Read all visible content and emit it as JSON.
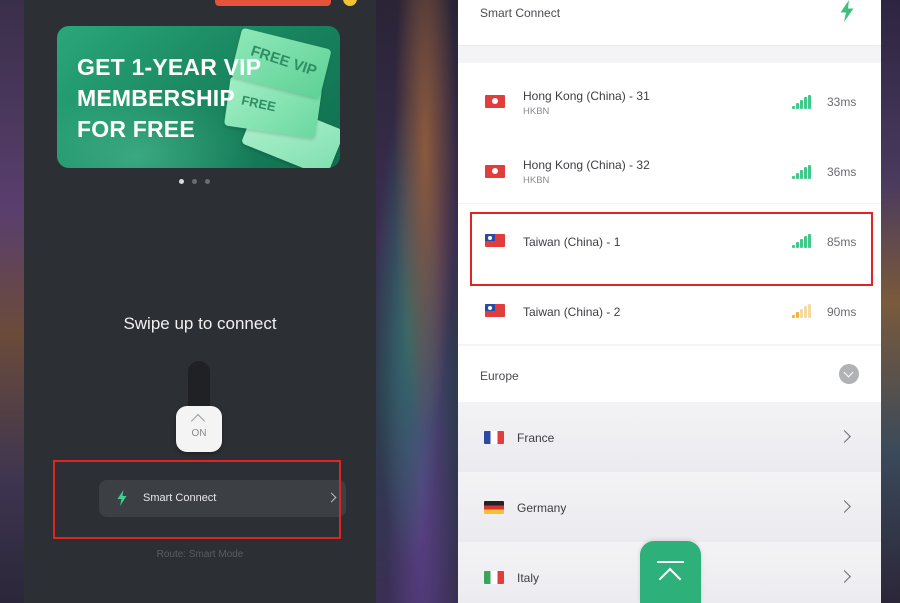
{
  "left_panel": {
    "banner": {
      "headline": "GET 1-YEAR VIP\nMEMBERSHIP\nFOR FREE",
      "ticket_label": "FREE VIP",
      "ticket_label_2": "FREE"
    },
    "carousel": {
      "count": 3,
      "active_index": 0
    },
    "swipe_text": "Swipe up to connect",
    "toggle_label": "ON",
    "mode_button": {
      "icon": "bolt-icon",
      "label": "Smart Connect"
    },
    "route_text": "Route: Smart Mode"
  },
  "right_panel": {
    "header": {
      "title": "Smart Connect",
      "icon": "bolt-icon"
    },
    "servers": [
      {
        "name": "Hong Kong (China) - 31",
        "provider": "HKBN",
        "flag": "hong-kong-flag",
        "latency": "33ms",
        "signal": "strong"
      },
      {
        "name": "Hong Kong (China) - 32",
        "provider": "HKBN",
        "flag": "hong-kong-flag",
        "latency": "36ms",
        "signal": "strong"
      },
      {
        "name": "Taiwan (China) - 1",
        "provider": "",
        "flag": "taiwan-flag",
        "latency": "85ms",
        "signal": "strong",
        "highlighted": true
      },
      {
        "name": "Taiwan (China) - 2",
        "provider": "",
        "flag": "taiwan-flag",
        "latency": "90ms",
        "signal": "weak"
      }
    ],
    "region": {
      "title": "Europe"
    },
    "countries": [
      {
        "name": "France",
        "flag": "france-flag"
      },
      {
        "name": "Germany",
        "flag": "germany-flag"
      },
      {
        "name": "Italy",
        "flag": "italy-flag"
      }
    ],
    "scroll_top_icon": "scroll-to-top-icon"
  },
  "colors": {
    "accent_green": "#2eb07a",
    "highlight_red": "#e02424",
    "signal_weak": "#f0b43a"
  }
}
